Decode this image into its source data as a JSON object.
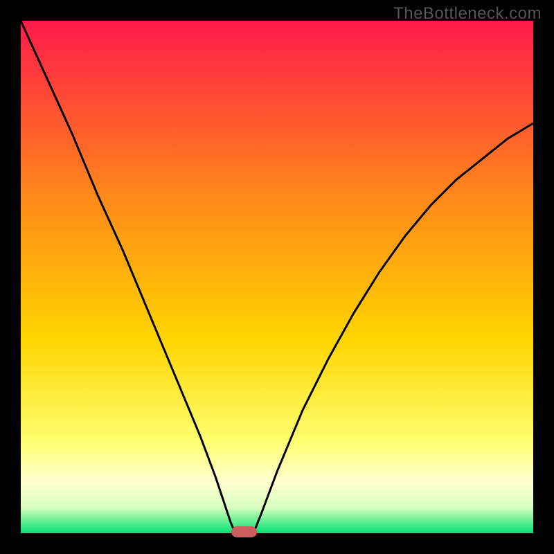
{
  "watermark": "TheBottleneck.com",
  "colors": {
    "frame": "#000000",
    "gradient_top": "#ff1a4a",
    "gradient_mid": "#ffd400",
    "gradient_low": "#ffffa0",
    "gradient_bottom": "#00e070",
    "curve": "#000000",
    "marker": "#cd5c5c"
  },
  "chart_data": {
    "type": "line",
    "title": "",
    "xlabel": "",
    "ylabel": "",
    "xlim": [
      0,
      100
    ],
    "ylim": [
      0,
      100
    ],
    "series": [
      {
        "name": "left-curve",
        "x": [
          0,
          5,
          10,
          15,
          20,
          25,
          30,
          35,
          38,
          40,
          41,
          41.9
        ],
        "values": [
          100,
          89,
          78,
          66,
          55,
          43,
          31,
          19,
          11,
          5,
          2,
          0
        ]
      },
      {
        "name": "right-curve",
        "x": [
          45.4,
          47,
          50,
          55,
          60,
          65,
          70,
          75,
          80,
          85,
          90,
          95,
          100
        ],
        "values": [
          0,
          4,
          12,
          24,
          34,
          43,
          51,
          58,
          64,
          69,
          73,
          77,
          80
        ]
      }
    ],
    "marker": {
      "x_center": 43.6,
      "width": 5
    }
  }
}
